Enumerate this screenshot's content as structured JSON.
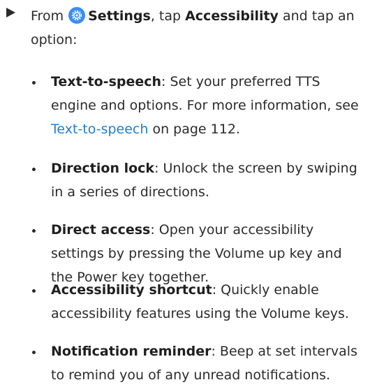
{
  "step": {
    "from": "From",
    "settings_label": "Settings",
    "mid": ", tap",
    "accessibility_label": "Accessibility",
    "tail": "and tap an option:"
  },
  "items": [
    {
      "term": "Text-to-speech",
      "desc": ": Set your preferred TTS engine and options. For more information, see",
      "link": "Text-to-speech",
      "after": "on page 112."
    },
    {
      "term": "Direction lock",
      "desc": ": Unlock the screen by swiping in a series of directions."
    },
    {
      "term": "Direct access",
      "desc": ": Open your accessibility settings by pressing the Volume up key and the Power key together."
    },
    {
      "term": "Accessibility shortcut",
      "desc": ": Quickly enable accessibility features using the Volume keys."
    },
    {
      "term": "Notification reminder",
      "desc": ": Beep at set intervals to remind you of any unread notifications."
    }
  ],
  "colors": {
    "link": "#1f7fcf",
    "settings_icon": "#3b8ef0"
  },
  "icons": {
    "step_marker": "triangle-right-icon",
    "settings": "settings-gear-icon"
  }
}
